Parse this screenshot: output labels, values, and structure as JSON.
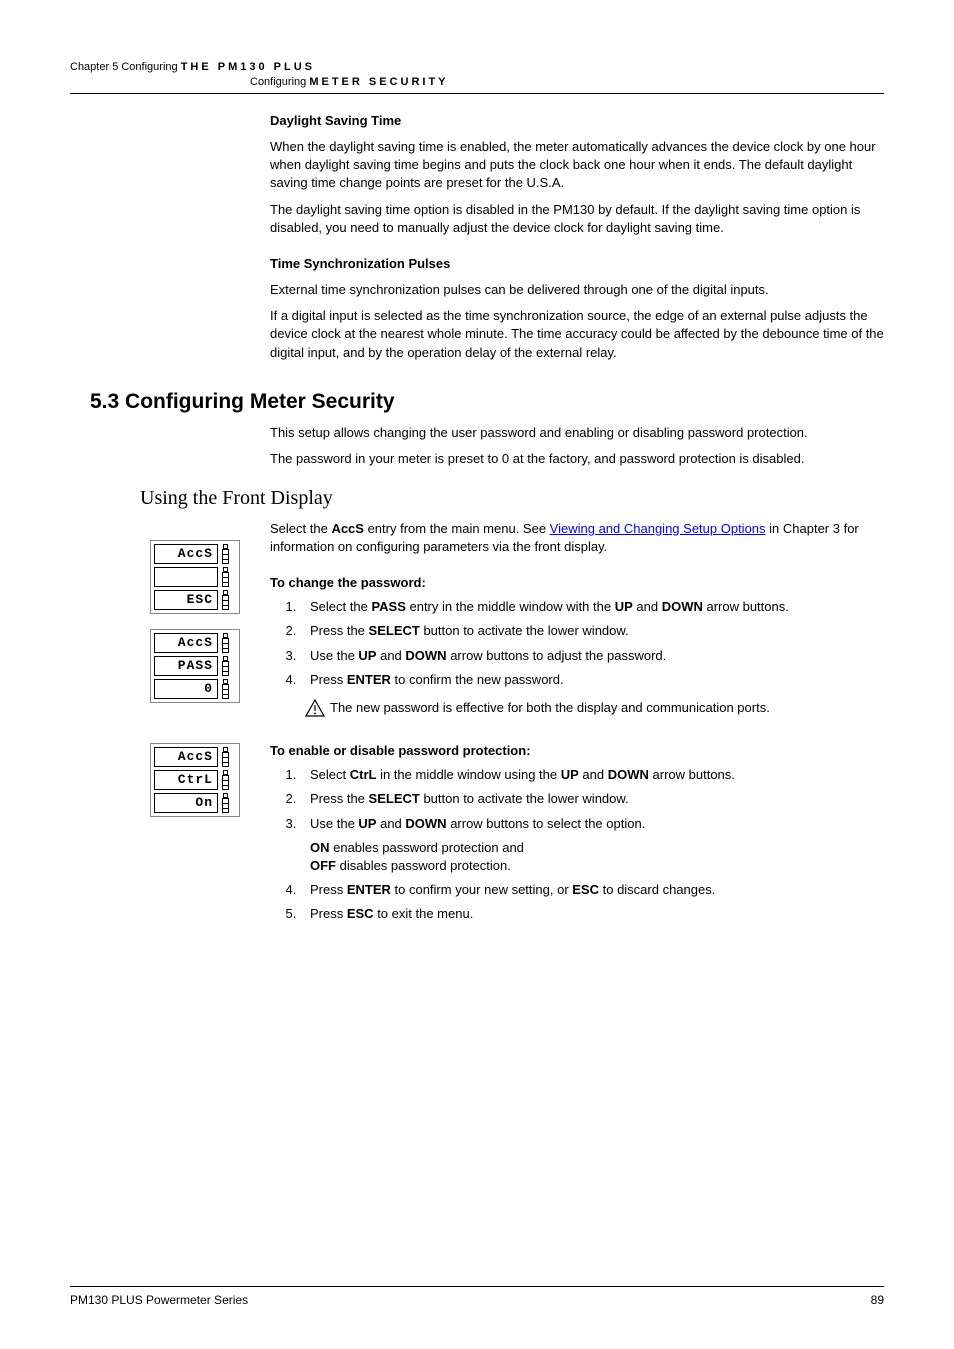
{
  "header": {
    "line1_left": "Chapter 5   Configuring",
    "line1_spaced": "THE PM130 PLUS",
    "line2_left": "Configuring",
    "line2_spaced": "METER SECURITY"
  },
  "sec_dst": {
    "heading": "Daylight Saving Time",
    "p1": "When the daylight saving time is enabled, the meter automatically advances the device clock by one hour when daylight saving time begins and puts the clock back one hour when it ends. The default daylight saving time change points are preset for the U.S.A.",
    "p2": "The daylight saving time option is disabled in the PM130 by default. If the daylight saving time option is disabled, you need to manually adjust the device clock for daylight saving time."
  },
  "sec_tsp": {
    "heading": "Time Synchronization Pulses",
    "p1": "External time synchronization pulses can be delivered through one of the digital inputs.",
    "p2": "If a digital input is selected as the time synchronization source, the edge of an external pulse adjusts the device clock at the nearest whole minute. The time accuracy could be affected by the debounce time of the digital input, and by the operation delay of the external relay."
  },
  "sec_53": {
    "title": "5.3  Configuring Meter Security",
    "p1": "This setup allows changing the user password and enabling or disabling password protection.",
    "p2": "The password in your meter is preset to 0 at the factory, and password protection is disabled."
  },
  "sec_front": {
    "title": "Using the Front Display",
    "intro_pre": "Select the ",
    "intro_bold": "AccS",
    "intro_mid": " entry from the main menu. See ",
    "intro_link": "Viewing and Changing Setup Options",
    "intro_post": " in Chapter 3 for information on configuring parameters via the front display."
  },
  "change_pw": {
    "heading": "To change the password:",
    "s1a": "Select the ",
    "s1_pass": "PASS",
    "s1b": " entry in the middle window with the ",
    "s1_up": "UP",
    "s1c": " and ",
    "s1_down": "DOWN",
    "s1d": " arrow buttons.",
    "s2a": "Press the ",
    "s2_sel": "SELECT",
    "s2b": " button to activate the lower window.",
    "s3a": "Use the ",
    "s3_up": "UP",
    "s3b": " and ",
    "s3_down": "DOWN",
    "s3c": " arrow buttons to adjust the password.",
    "s4a": "Press ",
    "s4_ent": "ENTER",
    "s4b": " to confirm the new password.",
    "warn": "The new password is effective for both the display and communication ports."
  },
  "enable_pw": {
    "heading": "To enable or disable password protection:",
    "s1a": "Select ",
    "s1_ctrl": "CtrL",
    "s1b": " in the middle window using the ",
    "s1_up": "UP",
    "s1c": " and ",
    "s1_down": "DOWN",
    "s1d": " arrow buttons.",
    "s2a": "Press the ",
    "s2_sel": "SELECT",
    "s2b": " button to activate the lower window.",
    "s3a": "Use the ",
    "s3_up": "UP",
    "s3b": " and ",
    "s3_down": "DOWN",
    "s3c": " arrow buttons to select the option.",
    "s3_on": "ON",
    "s3_on_txt": " enables password protection and",
    "s3_off": "OFF",
    "s3_off_txt": " disables password protection.",
    "s4a": "Press ",
    "s4_ent": "ENTER",
    "s4b": " to confirm your new setting, or ",
    "s4_esc": "ESC",
    "s4c": " to discard changes.",
    "s5a": "Press ",
    "s5_esc": "ESC",
    "s5b": " to exit the menu."
  },
  "displays": {
    "d1": {
      "r1": "AccS",
      "r2": "",
      "r3": "ESC"
    },
    "d2": {
      "r1": "AccS",
      "r2": "PASS",
      "r3": "0"
    },
    "d3": {
      "r1": "AccS",
      "r2": "CtrL",
      "r3": "On"
    }
  },
  "footer": {
    "left": "PM130 PLUS Powermeter Series",
    "right": "89"
  }
}
